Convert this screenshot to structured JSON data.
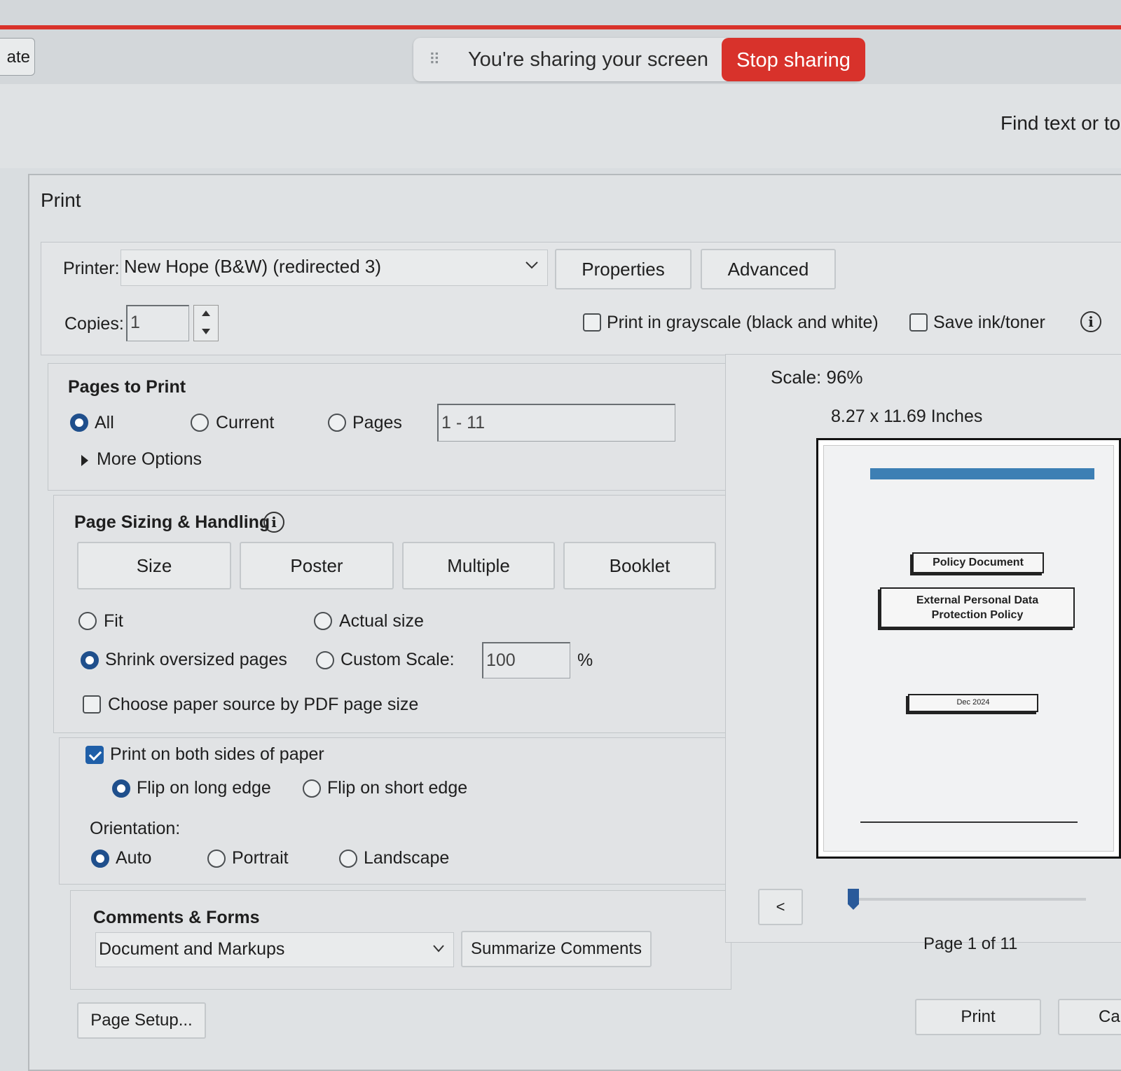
{
  "topbar": {
    "left_tab_label": "ate",
    "share_text": "You're sharing your screen",
    "stop_label": "Stop sharing",
    "find_text": "Find text or to"
  },
  "dialog": {
    "title": "Print",
    "printer_label": "Printer:",
    "printer_value": "New Hope (B&W) (redirected 3)",
    "properties_label": "Properties",
    "advanced_label": "Advanced",
    "copies_label": "Copies:",
    "copies_value": "1",
    "grayscale_label": "Print in grayscale (black and white)",
    "grayscale_checked": false,
    "save_ink_label": "Save ink/toner",
    "save_ink_checked": false
  },
  "pages_to_print": {
    "heading": "Pages to Print",
    "all_label": "All",
    "current_label": "Current",
    "pages_label": "Pages",
    "pages_value": "1 - 11",
    "selected": "All",
    "more_options_label": "More Options"
  },
  "sizing": {
    "heading": "Page Sizing & Handling",
    "tabs": [
      "Size",
      "Poster",
      "Multiple",
      "Booklet"
    ],
    "fit_label": "Fit",
    "actual_size_label": "Actual size",
    "shrink_label": "Shrink oversized pages",
    "custom_scale_label": "Custom Scale:",
    "custom_scale_value": "100",
    "percent_label": "%",
    "selected": "Shrink oversized pages",
    "paper_source_label": "Choose paper source by PDF page size",
    "paper_source_checked": false
  },
  "duplex": {
    "both_sides_label": "Print on both sides of paper",
    "both_sides_checked": true,
    "long_edge_label": "Flip on long edge",
    "short_edge_label": "Flip on short edge",
    "selected": "Flip on long edge",
    "orientation_label": "Orientation:",
    "auto_label": "Auto",
    "portrait_label": "Portrait",
    "landscape_label": "Landscape",
    "orientation_selected": "Auto"
  },
  "comments": {
    "heading": "Comments & Forms",
    "value": "Document and Markups",
    "summarize_label": "Summarize Comments"
  },
  "preview": {
    "scale_text": "Scale: 96%",
    "size_text": "8.27 x 11.69 Inches",
    "page_indicator": "Page 1 of 11",
    "prev_label": "<",
    "slider_position": 0,
    "doc": {
      "header_bar_color": "#3d7fb4",
      "policy_label": "Policy Document",
      "title_line1": "External Personal Data",
      "title_line2": "Protection Policy",
      "date_label": "Dec 2024"
    }
  },
  "footer": {
    "page_setup_label": "Page Setup...",
    "print_label": "Print",
    "cancel_label": "Car"
  }
}
